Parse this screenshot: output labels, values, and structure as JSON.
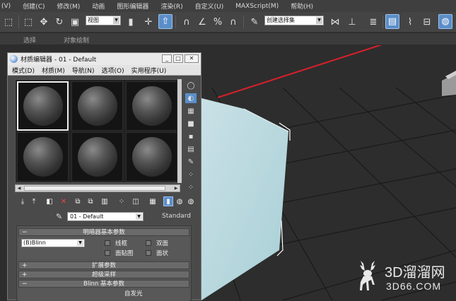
{
  "menubar": {
    "items": [
      "(V)",
      "创建(C)",
      "修改(M)",
      "动画",
      "图形编辑器",
      "渲染(R)",
      "自定义(U)",
      "MAXScript(M)",
      "帮助(H)"
    ]
  },
  "toolbar": {
    "view_dropdown": "视图",
    "selection_set_dropdown": "创建选择集",
    "material_editor_button": "材质编辑器"
  },
  "ribbon": {
    "labels": [
      "选择",
      "对象绘制"
    ]
  },
  "material_editor": {
    "title": "材质编辑器 - 01 - Default",
    "menu": [
      "模式(D)",
      "材质(M)",
      "导航(N)",
      "选项(O)",
      "实用程序(U)"
    ],
    "material_name": "01 - Default",
    "material_type": "Standard",
    "rollouts": {
      "shader_basic": "明暗器基本参数",
      "expanded": "扩展参数",
      "supersampling": "超级采样",
      "blinn_basic": "Blinn 基本参数"
    },
    "shader_value": "(B)Blinn",
    "checkboxes": {
      "wire": "线框",
      "two_sided": "双面",
      "face_map": "面贴图",
      "faceted": "面状"
    },
    "self_illum": "自发光"
  },
  "watermark": {
    "brand": "3D溜溜网",
    "domain": "3D66.COM"
  },
  "colors": {
    "accent": "#5b8ec9",
    "viewport_bg": "#2d2d2d",
    "box_color": "#bcd9df",
    "arrow": "#d8202a"
  }
}
